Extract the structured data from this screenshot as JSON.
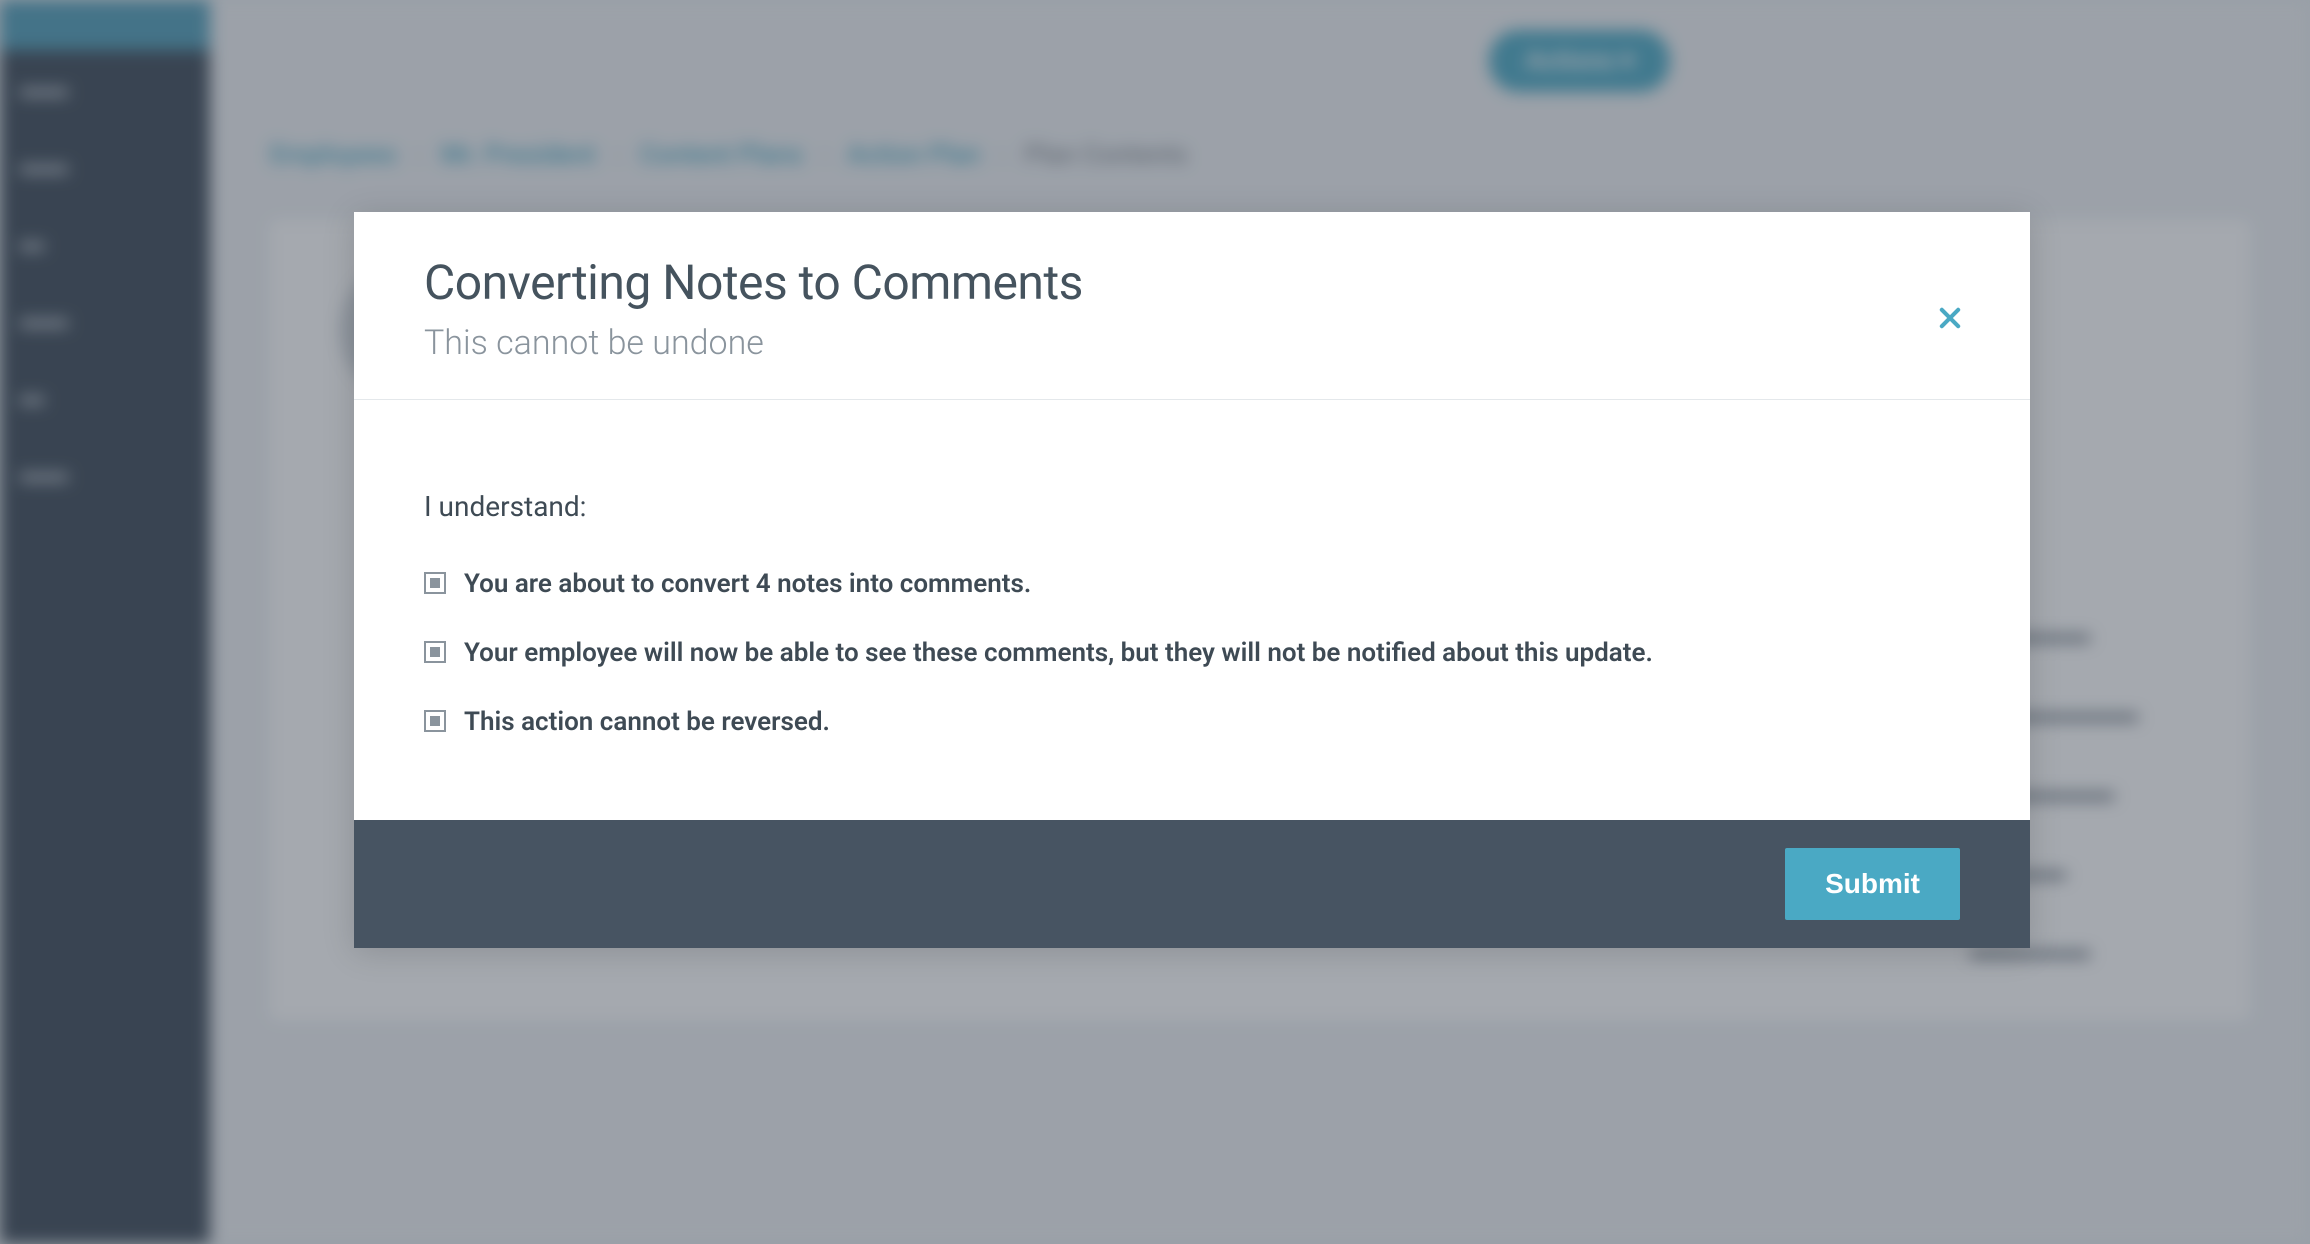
{
  "modal": {
    "title": "Converting Notes to Comments",
    "subtitle": "This cannot be undone",
    "intro": "I understand:",
    "items": [
      "You are about to convert 4 notes into comments.",
      "Your employee will now be able to see these comments, but they will not be notified about this update.",
      "This action cannot be reversed."
    ],
    "submit_label": "Submit"
  },
  "background": {
    "action_button": "Actions",
    "breadcrumb": {
      "items": [
        "Employees",
        "Mr. President",
        "Content Plans",
        "Action Plan"
      ],
      "last": "Plan Contents"
    }
  }
}
